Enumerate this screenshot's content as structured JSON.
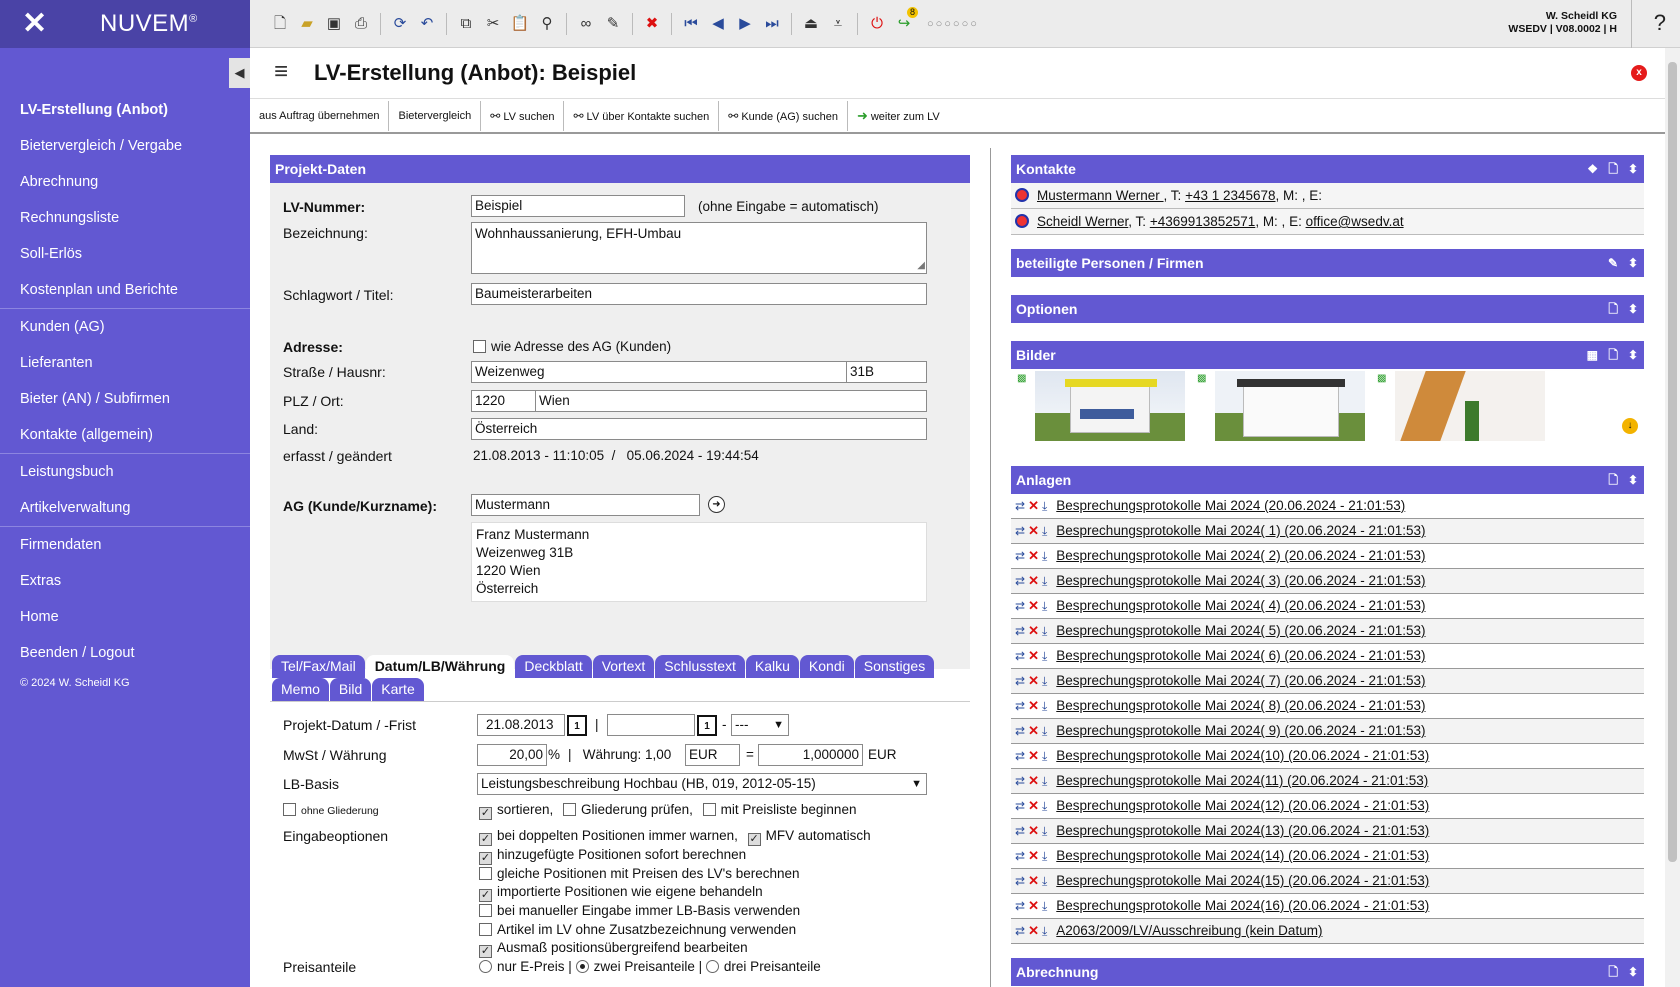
{
  "brand": {
    "name": "NUVEM",
    "reg": "®"
  },
  "sidebar": {
    "items": [
      {
        "label": "LV-Erstellung (Anbot)",
        "active": true
      },
      {
        "label": "Bietervergleich / Vergabe"
      },
      {
        "label": "Abrechnung"
      },
      {
        "label": "Rechnungsliste"
      },
      {
        "label": "Soll-Erlös"
      },
      {
        "label": "Kostenplan und Berichte"
      },
      {
        "label": "Kunden (AG)"
      },
      {
        "label": "Lieferanten"
      },
      {
        "label": "Bieter (AN) / Subfirmen"
      },
      {
        "label": "Kontakte (allgemein)"
      },
      {
        "label": "Leistungsbuch"
      },
      {
        "label": "Artikelverwaltung"
      },
      {
        "label": "Firmendaten"
      },
      {
        "label": "Extras"
      },
      {
        "label": "Home"
      },
      {
        "label": "Beenden / Logout"
      }
    ],
    "copyright": "© 2024 W. Scheidl KG"
  },
  "topbar": {
    "user_line1": "W. Scheidl KG",
    "user_line2": "WSEDV | V08.0002 | H",
    "help": "?",
    "dots": "○○○○○○",
    "badge": "8"
  },
  "title": "LV-Erstellung (Anbot): Beispiel",
  "close_label": "x",
  "actions": [
    {
      "label": "aus Auftrag übernehmen",
      "icon": ""
    },
    {
      "label": "Bietervergleich",
      "icon": ""
    },
    {
      "label": "LV suchen",
      "icon": "binoculars-icon"
    },
    {
      "label": "LV über Kontakte suchen",
      "icon": "binoculars-icon"
    },
    {
      "label": "Kunde (AG) suchen",
      "icon": "binoculars-icon"
    },
    {
      "label": "weiter zum LV",
      "icon": "arrow-right-icon"
    }
  ],
  "projekt": {
    "heading": "Projekt-Daten",
    "lv_nummer_label": "LV-Nummer:",
    "lv_nummer": "Beispiel",
    "lv_nummer_hint": "(ohne Eingabe = automatisch)",
    "bezeichnung_label": "Bezeichnung:",
    "bezeichnung": "Wohnhaussanierung, EFH-Umbau",
    "schlagwort_label": "Schlagwort / Titel:",
    "schlagwort": "Baumeisterarbeiten",
    "adresse_label": "Adresse:",
    "adresse_ag_label": "wie Adresse des AG (Kunden)",
    "strasse_label": "Straße / Hausnr:",
    "strasse": "Weizenweg",
    "hausnr": "31B",
    "plz_label": "PLZ / Ort:",
    "plz": "1220",
    "ort": "Wien",
    "land_label": "Land:",
    "land": "Österreich",
    "erfasst_label": "erfasst / geändert",
    "erfasst": "21.08.2013 - 11:10:05  /   05.06.2024 - 19:44:54",
    "ag_label": "AG (Kunde/Kurzname):",
    "ag": "Mustermann",
    "ag_address": [
      "Franz Mustermann",
      "Weizenweg 31B",
      "1220 Wien",
      "Österreich"
    ]
  },
  "tabs_row1": [
    {
      "label": "Tel/Fax/Mail"
    },
    {
      "label": "Datum/LB/Währung",
      "active": true
    },
    {
      "label": "Deckblatt"
    },
    {
      "label": "Vortext"
    },
    {
      "label": "Schlusstext"
    },
    {
      "label": "Kalku"
    },
    {
      "label": "Kondi"
    },
    {
      "label": "Sonstiges"
    }
  ],
  "tabs_row2": [
    {
      "label": "Memo"
    },
    {
      "label": "Bild"
    },
    {
      "label": "Karte"
    }
  ],
  "datum": {
    "projekt_datum_label": "Projekt-Datum / -Frist",
    "projekt_datum": "21.08.2013",
    "cal": "1",
    "frist_sep": "|",
    "frist_dash": "-",
    "frist_select": "---",
    "mwst_label": "MwSt / Währung",
    "mwst": "20,00",
    "pct": "%",
    "waehrung_prefix": "|   Währung: 1,00",
    "waehrung": "EUR",
    "eq": "=",
    "kurs": "1,000000",
    "kurs_unit": "EUR",
    "lb_label": "LB-Basis",
    "lb": "Leistungsbeschreibung Hochbau (HB, 019, 2012-05-15)",
    "ohne_gliederung": "ohne Gliederung",
    "sortieren": "sortieren,",
    "gliederung_pruefen": "Gliederung prüfen,",
    "mit_preisliste": "mit Preisliste beginnen",
    "eingabe_label": "Eingabeoptionen",
    "opt1": "bei doppelten Positionen immer warnen,",
    "opt1b": "MFV automatisch",
    "opt2": "hinzugefügte Positionen sofort berechnen",
    "opt3": "gleiche Positionen mit Preisen des LV's berechnen",
    "opt4": "importierte Positionen wie eigene behandeln",
    "opt5": "bei manueller Eingabe immer LB-Basis verwenden",
    "opt6": "Artikel im LV ohne Zusatzbezeichnung verwenden",
    "opt7": "Ausmaß positionsübergreifend bearbeiten",
    "preis_label": "Preisanteile",
    "preis1": "nur E-Preis",
    "preis2": "zwei Preisanteile",
    "preis3": "drei Preisanteile",
    "bar": "|"
  },
  "kontakte": {
    "heading": "Kontakte",
    "rows": [
      {
        "name": "Mustermann Werner ",
        "t_label": ", T: ",
        "phone": "+43 1 2345678",
        "rest": ", M: , E:",
        "email": ""
      },
      {
        "name": "Scheidl Werner",
        "t_label": ", T: ",
        "phone": "+4369913852571",
        "rest": ", M: , E: ",
        "email": "office@wsedv.at"
      }
    ]
  },
  "beteiligte": {
    "heading": "beteiligte Personen / Firmen"
  },
  "optionen": {
    "heading": "Optionen"
  },
  "bilder": {
    "heading": "Bilder"
  },
  "anlagen": {
    "heading": "Anlagen",
    "items": [
      "Besprechungsprotokolle Mai 2024 (20.06.2024 - 21:01:53)",
      "Besprechungsprotokolle Mai 2024( 1) (20.06.2024 - 21:01:53)",
      "Besprechungsprotokolle Mai 2024( 2) (20.06.2024 - 21:01:53)",
      "Besprechungsprotokolle Mai 2024( 3) (20.06.2024 - 21:01:53)",
      "Besprechungsprotokolle Mai 2024( 4) (20.06.2024 - 21:01:53)",
      "Besprechungsprotokolle Mai 2024( 5) (20.06.2024 - 21:01:53)",
      "Besprechungsprotokolle Mai 2024( 6) (20.06.2024 - 21:01:53)",
      "Besprechungsprotokolle Mai 2024( 7) (20.06.2024 - 21:01:53)",
      "Besprechungsprotokolle Mai 2024( 8) (20.06.2024 - 21:01:53)",
      "Besprechungsprotokolle Mai 2024( 9) (20.06.2024 - 21:01:53)",
      "Besprechungsprotokolle Mai 2024(10) (20.06.2024 - 21:01:53)",
      "Besprechungsprotokolle Mai 2024(11) (20.06.2024 - 21:01:53)",
      "Besprechungsprotokolle Mai 2024(12) (20.06.2024 - 21:01:53)",
      "Besprechungsprotokolle Mai 2024(13) (20.06.2024 - 21:01:53)",
      "Besprechungsprotokolle Mai 2024(14) (20.06.2024 - 21:01:53)",
      "Besprechungsprotokolle Mai 2024(15) (20.06.2024 - 21:01:53)",
      "Besprechungsprotokolle Mai 2024(16) (20.06.2024 - 21:01:53)",
      "A2063/2009/LV/Ausschreibung (kein Datum)"
    ]
  },
  "abrechnung": {
    "heading": "Abrechnung"
  },
  "colors": {
    "accent": "#6258d2",
    "brand_dark": "#4a43a6",
    "danger": "#e51b1b"
  }
}
